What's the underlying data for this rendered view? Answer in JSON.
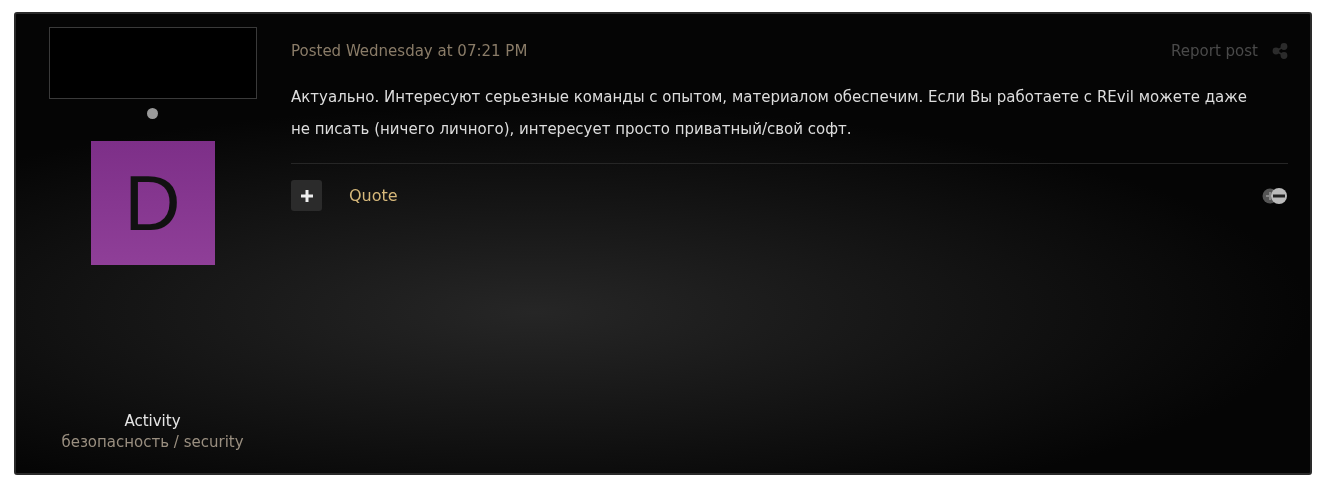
{
  "author": {
    "avatar_letter": "D",
    "activity_label": "Activity",
    "activity_value": "безопасность / security"
  },
  "post": {
    "timestamp": "Posted Wednesday at 07:21 PM",
    "report_link": "Report post",
    "body": "Актуально. Интересуют серьезные команды с опытом, материалом обеспечим. Если Вы работаете с REvil можете даже не писать (ничего личного), интересует просто приватный/свой софт.",
    "quote_label": "Quote"
  }
}
